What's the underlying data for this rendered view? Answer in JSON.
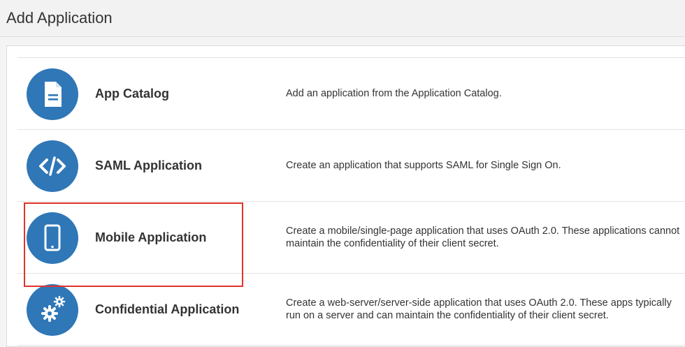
{
  "header": {
    "title": "Add Application"
  },
  "items": [
    {
      "name": "App Catalog",
      "description": "Add an application from the Application Catalog.",
      "icon": "document-icon"
    },
    {
      "name": "SAML Application",
      "description": "Create an application that supports SAML for Single Sign On.",
      "icon": "code-icon"
    },
    {
      "name": "Mobile Application",
      "description": "Create a mobile/single-page application that uses OAuth 2.0. These applications cannot maintain the confidentiality of their client secret.",
      "icon": "mobile-icon"
    },
    {
      "name": "Confidential Application",
      "description": "Create a web-server/server-side application that uses OAuth 2.0. These apps typically run on a server and can maintain the confidentiality of their client secret.",
      "icon": "gears-icon"
    }
  ],
  "colors": {
    "icon_background": "#2f77b7",
    "highlight_border": "#e0332a"
  }
}
